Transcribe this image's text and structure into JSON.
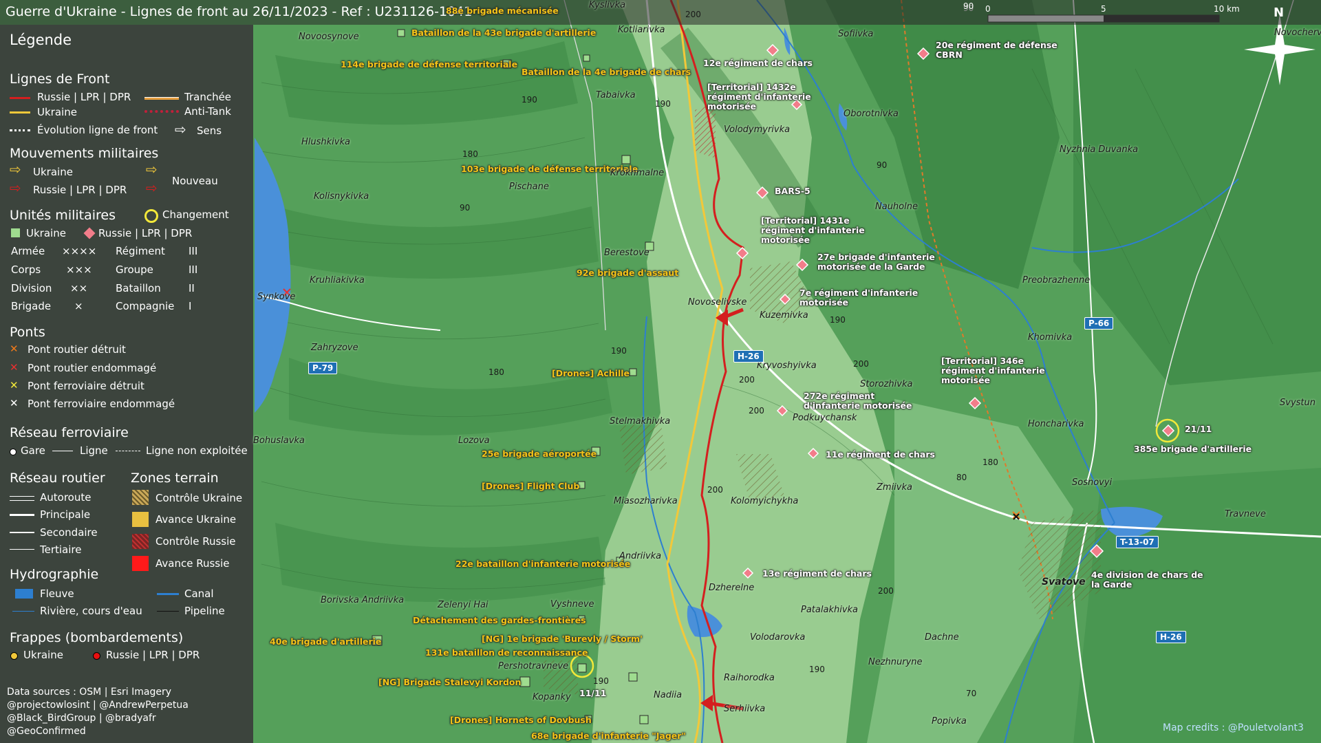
{
  "title": "Guerre d'Ukraine - Lignes de front au 26/11/2023 - Ref : U231126-1041",
  "scale": {
    "labels": [
      "0",
      "5",
      "10 km"
    ]
  },
  "north_label": "N",
  "legend": {
    "title": "Légende",
    "front": {
      "heading": "Lignes de Front",
      "russia": "Russie | LPR | DPR",
      "ukraine": "Ukraine",
      "evolution": "Évolution ligne de front",
      "trench": "Tranchée",
      "antitank": "Anti-Tank",
      "direction": "Sens"
    },
    "movements": {
      "heading": "Mouvements militaires",
      "ukraine": "Ukraine",
      "russia": "Russie | LPR | DPR",
      "new": "Nouveau"
    },
    "units": {
      "heading": "Unités militaires",
      "change": "Changement",
      "ukraine": "Ukraine",
      "russia": "Russie | LPR | DPR",
      "rows": [
        {
          "a": "Armée",
          "as": "××××",
          "b": "Régiment",
          "bs": "III"
        },
        {
          "a": "Corps",
          "as": "×××",
          "b": "Groupe",
          "bs": "III"
        },
        {
          "a": "Division",
          "as": "××",
          "b": "Bataillon",
          "bs": "II"
        },
        {
          "a": "Brigade",
          "as": "×",
          "b": "Compagnie",
          "bs": "I"
        }
      ]
    },
    "bridges": {
      "heading": "Ponts",
      "items": [
        "Pont routier détruit",
        "Pont routier endommagé",
        "Pont ferroviaire détruit",
        "Pont ferroviaire endommagé"
      ]
    },
    "rail": {
      "heading": "Réseau ferroviaire",
      "station": "Gare",
      "line": "Ligne",
      "unused": "Ligne non exploitée"
    },
    "roads": {
      "heading": "Réseau routier",
      "items": [
        "Autoroute",
        "Principale",
        "Secondaire",
        "Tertiaire"
      ]
    },
    "zones": {
      "heading": "Zones terrain",
      "items": [
        "Contrôle Ukraine",
        "Avance Ukraine",
        "Contrôle Russie",
        "Avance Russie"
      ]
    },
    "hydro": {
      "heading": "Hydrographie",
      "river": "Fleuve",
      "canal": "Canal",
      "stream": "Rivière, cours d'eau",
      "pipeline": "Pipeline"
    },
    "strikes": {
      "heading": "Frappes (bombardements)",
      "ukraine": "Ukraine",
      "russia": "Russie | LPR | DPR"
    },
    "sources": [
      "Data sources : OSM | Esri Imagery",
      "@projectowlosint | @AndrewPerpetua",
      "@Black_BirdGroup | @bradyafr",
      "@GeoConfirmed"
    ]
  },
  "map_credit": "Map credits : @Pouletvolant3",
  "colors": {
    "russia": "#d41f1f",
    "ukraine": "#f2c83a",
    "water": "#4a90d9",
    "legend_bg": "#3a3a3a"
  },
  "ukraine_units": [
    "88e brigade mécanisée",
    "Bataillon de la 43e brigade d'artillerie",
    "114e brigade de défense territoriale",
    "Bataillon de la 4e brigade de chars",
    "103e brigade de défense territoriale",
    "92e brigade d'assaut",
    "[Drones] Achille",
    "25e brigade aéroportée",
    "[Drones] Flight Club",
    "22e bataillon d'infanterie motorisée",
    "Détachement des gardes-frontières",
    "[NG] 1e brigade 'Burevly / Storm'",
    "131e bataillon de reconnaissance",
    "40e brigade d'artillerie",
    "[NG] Brigade Stalevyi Kordon",
    "[Drones] Hornets of Dovbush",
    "68e brigade d'infanterie \"Jager\""
  ],
  "russia_units": [
    "12e régiment de chars",
    "[Territorial] 1432e\nrégiment d'infanterie\nmotorisée",
    "20e régiment de défense\nCBRN",
    "BARS-5",
    "[Territorial] 1431e\nrégiment d'infanterie\nmotorisée",
    "27e brigade d'infanterie\nmotorisée de la Garde",
    "7e régiment d'infanterie\nmotorisée",
    "[Territorial] 346e\nrégiment d'infanterie\nmotorisée",
    "272e régiment\nd'infanterie motorisée",
    "11e régiment de chars",
    "385e brigade d'artillerie",
    "4e division de chars de\nla Garde",
    "13e régiment de chars"
  ],
  "dates": {
    "a": "21/11",
    "b": "11/11"
  },
  "places": [
    "Kyslivka",
    "Novoosynove",
    "Kotliarivka",
    "Sofiivka",
    "Tabaivka",
    "Volodymyrivka",
    "Oborotnivka",
    "Hlushkivka",
    "Nyzhnia Duvanka",
    "Krokhmalne",
    "Pischane",
    "Kolisnykivka",
    "Nauholne",
    "Berestove",
    "Kruhliakivka",
    "Preobrazhenne",
    "Novoselivske",
    "Kuzemivka",
    "Synkove",
    "Zahryzove",
    "Khomivka",
    "Kryvoshyivka",
    "Storozhivka",
    "Podkuychansk",
    "Honcharivka",
    "Stelmakhivka",
    "Bohuslavka",
    "Lozova",
    "Zmiivka",
    "Sosnovyi",
    "Svystun",
    "Miasozharivka",
    "Kolomyichykha",
    "Travneve",
    "Andriivka",
    "Svatove",
    "Dzherelne",
    "Borivska Andriivka",
    "Zelenyi Hai",
    "Vyshneve",
    "Patalakhivka",
    "Volodarovka",
    "Dachne",
    "Pershotravneve",
    "Raihorodka",
    "Nezhnuryne",
    "Kopanky",
    "Nadiia",
    "Serhiivka",
    "Popivka",
    "Novocherv"
  ],
  "elevations": [
    "200",
    "190",
    "190",
    "180",
    "90",
    "90",
    "190",
    "190",
    "180",
    "200",
    "200",
    "200",
    "180",
    "80",
    "200",
    "190",
    "190",
    "70",
    "200",
    "90"
  ],
  "roads": [
    "P-79",
    "H-26",
    "P-66",
    "T-13-07",
    "H-26"
  ]
}
